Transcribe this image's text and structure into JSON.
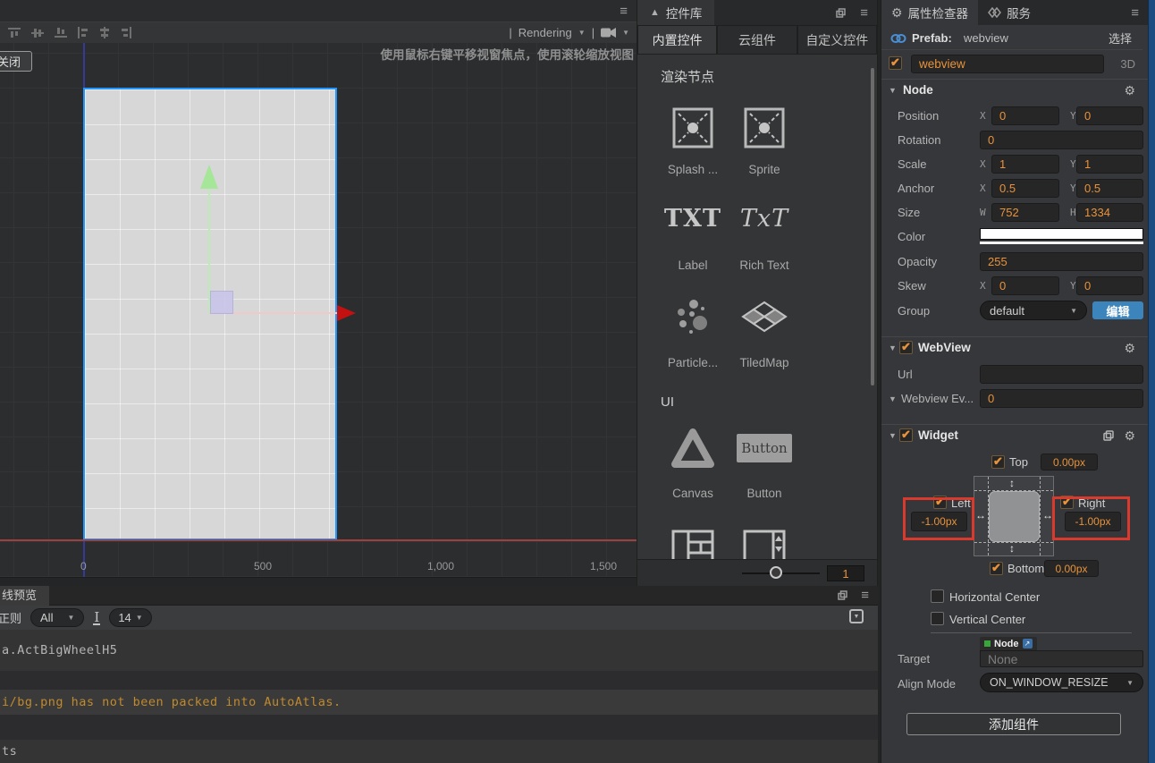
{
  "glyphs": {
    "menu": "≡",
    "dropdown": "▼",
    "collapsed": "▼",
    "triangle_up": "▲",
    "gear": "⚙",
    "arrow_h": "↔",
    "arrow_v": "↕",
    "external_link": "↗",
    "pipe": "|"
  },
  "scene": {
    "toolbar": {
      "rendering_label": "Rendering",
      "separator": "|"
    },
    "hint": "使用鼠标右键平移视窗焦点，使用滚轮缩放视图",
    "close_button": "关闭",
    "ruler_ticks": [
      "0",
      "500",
      "1,000",
      "1,500"
    ]
  },
  "library": {
    "panel_title": "控件库",
    "tabs": [
      "内置控件",
      "云组件",
      "自定义控件"
    ],
    "sections": {
      "render_nodes": "渲染节点",
      "ui": "UI"
    },
    "items": {
      "splash": {
        "label": "Splash ..."
      },
      "sprite": {
        "label": "Sprite"
      },
      "label": {
        "label": "Label",
        "icon_text": "TXT"
      },
      "richtext": {
        "label": "Rich Text",
        "icon_text": "TxT"
      },
      "particle": {
        "label": "Particle..."
      },
      "tiledmap": {
        "label": "TiledMap"
      },
      "canvas": {
        "label": "Canvas"
      },
      "button": {
        "label": "Button",
        "icon_text": "Button"
      }
    },
    "zoom_value": "1"
  },
  "console": {
    "tab": "线预览",
    "regex_label": "正则",
    "filter_all": "All",
    "font_size_icon": "I",
    "font_size": "14",
    "lines": {
      "l1": "a.ActBigWheelH5",
      "l2": "i/bg.png has not been packed into AutoAtlas.",
      "l3": "ts"
    }
  },
  "inspector": {
    "tab_inspector": "属性检查器",
    "tab_service": "服务",
    "prefab_label": "Prefab:",
    "prefab_name": "webview",
    "select_label": "选择",
    "node_name": "webview",
    "mode_3d": "3D",
    "axis": {
      "x": "X",
      "y": "Y",
      "w": "W",
      "h": "H"
    },
    "node": {
      "title": "Node",
      "position_label": "Position",
      "position_x": "0",
      "position_y": "0",
      "rotation_label": "Rotation",
      "rotation": "0",
      "scale_label": "Scale",
      "scale_x": "1",
      "scale_y": "1",
      "anchor_label": "Anchor",
      "anchor_x": "0.5",
      "anchor_y": "0.5",
      "size_label": "Size",
      "size_w": "752",
      "size_h": "1334",
      "color_label": "Color",
      "opacity_label": "Opacity",
      "opacity": "255",
      "skew_label": "Skew",
      "skew_x": "0",
      "skew_y": "0",
      "group_label": "Group",
      "group_value": "default",
      "group_edit": "编辑"
    },
    "webview": {
      "title": "WebView",
      "url_label": "Url",
      "event_label": "Webview Ev...",
      "event_value": "0"
    },
    "widget": {
      "title": "Widget",
      "top_label": "Top",
      "top_value": "0.00px",
      "left_label": "Left",
      "left_value": "-1.00px",
      "right_label": "Right",
      "right_value": "-1.00px",
      "bottom_label": "Bottom",
      "bottom_value": "0.00px",
      "h_center_label": "Horizontal Center",
      "v_center_label": "Vertical Center",
      "target_label": "Target",
      "target_type": "Node",
      "target_value": "None",
      "align_mode_label": "Align Mode",
      "align_mode_value": "ON_WINDOW_RESIZE"
    },
    "add_component": "添加组件"
  },
  "colors": {
    "accent_orange": "#e8923a",
    "accent_blue": "#3c84bc",
    "highlight_red": "#da392e",
    "prefab_blue": "#4a8fd4",
    "warning_text": "#c08a2e"
  }
}
